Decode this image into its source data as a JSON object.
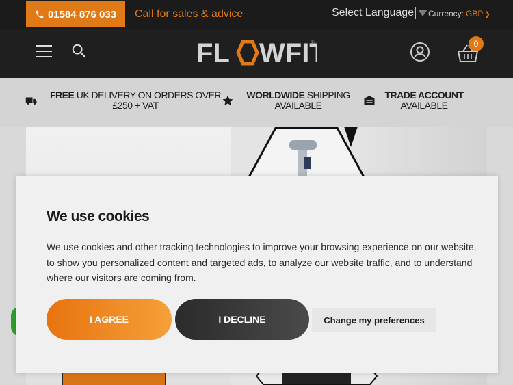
{
  "topbar": {
    "phone": "01584 876 033",
    "call_text": "Call for sales & advice",
    "language_label": "Select Language",
    "currency_label": "Currency:",
    "currency_value": "GBP"
  },
  "header": {
    "logo_text": "FLOWFIT",
    "basket_count": "0"
  },
  "usp": [
    {
      "bold": "FREE",
      "text": " UK DELIVERY ON ORDERS OVER £250 + VAT",
      "icon": "truck-icon"
    },
    {
      "bold": "WORLDWIDE",
      "text": " SHIPPING AVAILABLE",
      "icon": "star-icon"
    },
    {
      "bold": "TRADE ACCOUNT",
      "text": " AVAILABLE",
      "icon": "warehouse-icon"
    }
  ],
  "cookie": {
    "title": "We use cookies",
    "body": "We use cookies and other tracking technologies to improve your browsing experience on our website, to show you personalized content and targeted ads, to analyze our website traffic, and to understand where our visitors are coming from.",
    "agree": "I AGREE",
    "decline": "I DECLINE",
    "preferences": "Change my preferences"
  },
  "colors": {
    "accent": "#e07a17",
    "topbar_bg": "#1b1b1b",
    "header_bg": "#1f1f1f"
  }
}
